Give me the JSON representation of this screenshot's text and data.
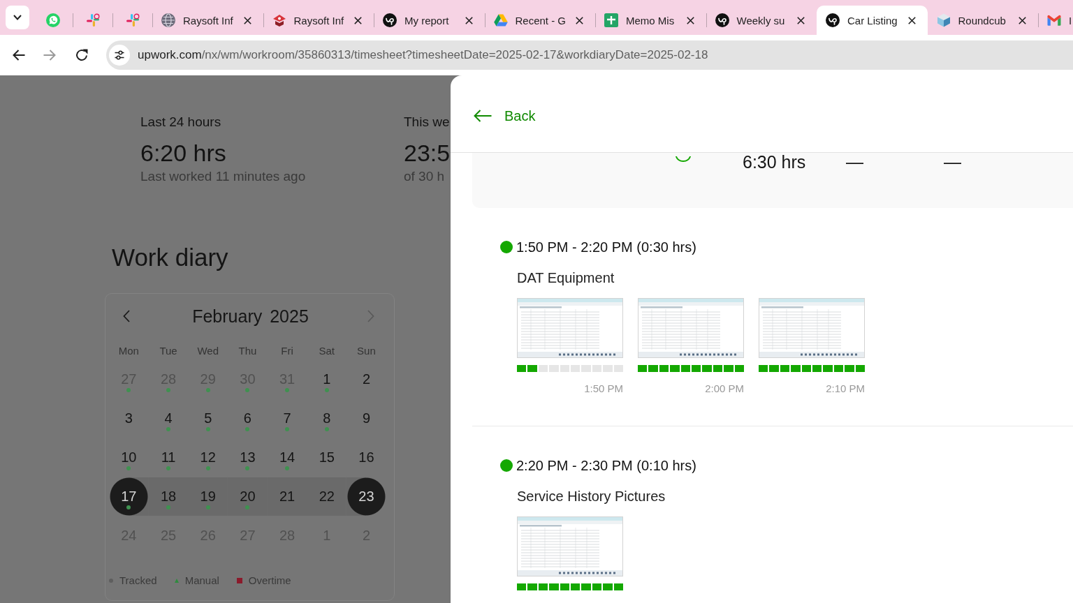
{
  "browser": {
    "tabs": [
      {
        "kind": "pinned",
        "selected": false
      },
      {
        "kind": "pinned",
        "selected": false
      },
      {
        "kind": "pinned",
        "selected": false
      },
      {
        "kind": "tab",
        "label": "Raysoft Inf",
        "selected": false
      },
      {
        "kind": "tab",
        "label": "Raysoft Inf",
        "selected": false
      },
      {
        "kind": "tab",
        "label": "My report",
        "selected": false
      },
      {
        "kind": "tab",
        "label": "Recent - G",
        "selected": false
      },
      {
        "kind": "tab",
        "label": "Memo Mis",
        "selected": false
      },
      {
        "kind": "tab",
        "label": "Weekly su",
        "selected": false
      },
      {
        "kind": "tab",
        "label": "Car Listing",
        "selected": true
      },
      {
        "kind": "tab",
        "label": "Roundcub",
        "selected": false
      },
      {
        "kind": "cut",
        "label": "I",
        "selected": false
      }
    ],
    "nav_buttons": [
      {
        "kind": "back",
        "disabled": false
      },
      {
        "kind": "forward",
        "disabled": true
      },
      {
        "kind": "reload",
        "disabled": false
      }
    ],
    "address": {
      "host": "upwork.com",
      "path": "/nx/wm/workroom/35860313/timesheet?timesheetDate=2025-02-17&workdiaryDate=2025-02-18"
    }
  },
  "stats": [
    {
      "label": "Last 24 hours",
      "value": "6:20 hrs",
      "note": "Last worked 11 minutes ago"
    },
    {
      "label": "This we",
      "value": "23:5",
      "note": "of 30 h"
    }
  ],
  "work_diary": {
    "title": "Work diary",
    "calendar": {
      "month": "February 2025",
      "nav": [
        {
          "kind": "prev",
          "disabled": false
        },
        {
          "kind": "next",
          "disabled": true
        }
      ],
      "weekdays": [
        "Mon",
        "Tue",
        "Wed",
        "Thu",
        "Fri",
        "Sat",
        "Sun"
      ],
      "weeks": [
        [
          {
            "label": "27",
            "outside": true,
            "tracked": true,
            "selected": false,
            "in_range": false
          },
          {
            "label": "28",
            "outside": true,
            "tracked": true,
            "selected": false,
            "in_range": false
          },
          {
            "label": "29",
            "outside": true,
            "tracked": true,
            "selected": false,
            "in_range": false
          },
          {
            "label": "30",
            "outside": true,
            "tracked": true,
            "selected": false,
            "in_range": false
          },
          {
            "label": "31",
            "outside": true,
            "tracked": true,
            "selected": false,
            "in_range": false
          },
          {
            "label": "1",
            "outside": false,
            "tracked": true,
            "selected": false,
            "in_range": false
          },
          {
            "label": "2",
            "outside": false,
            "tracked": false,
            "selected": false,
            "in_range": false
          }
        ],
        [
          {
            "label": "3",
            "outside": false,
            "tracked": false,
            "selected": false,
            "in_range": false
          },
          {
            "label": "4",
            "outside": false,
            "tracked": true,
            "selected": false,
            "in_range": false
          },
          {
            "label": "5",
            "outside": false,
            "tracked": true,
            "selected": false,
            "in_range": false
          },
          {
            "label": "6",
            "outside": false,
            "tracked": true,
            "selected": false,
            "in_range": false
          },
          {
            "label": "7",
            "outside": false,
            "tracked": true,
            "selected": false,
            "in_range": false
          },
          {
            "label": "8",
            "outside": false,
            "tracked": true,
            "selected": false,
            "in_range": false
          },
          {
            "label": "9",
            "outside": false,
            "tracked": false,
            "selected": false,
            "in_range": false
          }
        ],
        [
          {
            "label": "10",
            "outside": false,
            "tracked": true,
            "selected": false,
            "in_range": false
          },
          {
            "label": "11",
            "outside": false,
            "tracked": true,
            "selected": false,
            "in_range": false
          },
          {
            "label": "12",
            "outside": false,
            "tracked": true,
            "selected": false,
            "in_range": false
          },
          {
            "label": "13",
            "outside": false,
            "tracked": true,
            "selected": false,
            "in_range": false
          },
          {
            "label": "14",
            "outside": false,
            "tracked": true,
            "selected": false,
            "in_range": false
          },
          {
            "label": "15",
            "outside": false,
            "tracked": false,
            "selected": false,
            "in_range": false
          },
          {
            "label": "16",
            "outside": false,
            "tracked": false,
            "selected": false,
            "in_range": false
          }
        ],
        [
          {
            "label": "17",
            "outside": false,
            "tracked": true,
            "selected": true,
            "in_range": true
          },
          {
            "label": "18",
            "outside": false,
            "tracked": true,
            "selected": false,
            "in_range": true
          },
          {
            "label": "19",
            "outside": false,
            "tracked": true,
            "selected": false,
            "in_range": true
          },
          {
            "label": "20",
            "outside": false,
            "tracked": true,
            "selected": false,
            "in_range": true
          },
          {
            "label": "21",
            "outside": false,
            "tracked": false,
            "selected": false,
            "in_range": true
          },
          {
            "label": "22",
            "outside": false,
            "tracked": false,
            "selected": false,
            "in_range": true
          },
          {
            "label": "23",
            "outside": false,
            "tracked": false,
            "selected": true,
            "in_range": true
          }
        ],
        [
          {
            "label": "24",
            "outside": true,
            "tracked": false,
            "selected": false,
            "in_range": false
          },
          {
            "label": "25",
            "outside": true,
            "tracked": false,
            "selected": false,
            "in_range": false
          },
          {
            "label": "26",
            "outside": true,
            "tracked": false,
            "selected": false,
            "in_range": false
          },
          {
            "label": "27",
            "outside": true,
            "tracked": false,
            "selected": false,
            "in_range": false
          },
          {
            "label": "28",
            "outside": true,
            "tracked": false,
            "selected": false,
            "in_range": false
          },
          {
            "label": "1",
            "outside": true,
            "tracked": false,
            "selected": false,
            "in_range": false
          },
          {
            "label": "2",
            "outside": true,
            "tracked": false,
            "selected": false,
            "in_range": false
          }
        ]
      ]
    },
    "legend": [
      {
        "kind": "dot",
        "label": "Tracked",
        "color": "#5e5e5e"
      },
      {
        "kind": "triangle",
        "label": "Manual",
        "color": "#2e8b3e"
      },
      {
        "kind": "square",
        "label": "Overtime",
        "color": "#8b1a2b"
      }
    ]
  },
  "drawer": {
    "back": "Back",
    "summary": {
      "values": [
        "6:30 hrs",
        "—",
        "—"
      ]
    },
    "segments": [
      {
        "time": "1:50 PM - 2:20 PM (0:30 hrs)",
        "memo": "DAT Equipment",
        "snapshots": [
          {
            "time": "1:50 PM",
            "level": 0.2
          },
          {
            "time": "2:00 PM",
            "level": 1
          },
          {
            "time": "2:10 PM",
            "level": 1
          }
        ]
      },
      {
        "time": "2:20 PM - 2:30 PM (0:10 hrs)",
        "memo": "Service History Pictures",
        "snapshots": [
          {
            "level": 1
          }
        ]
      }
    ]
  }
}
